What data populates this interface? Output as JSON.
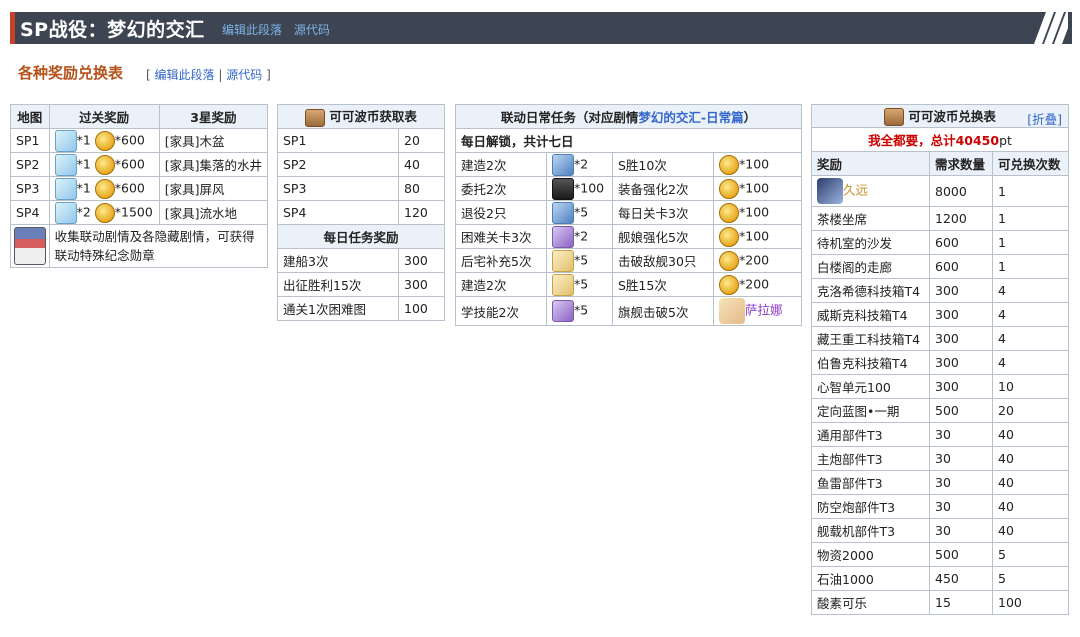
{
  "banner": {
    "title": "SP战役：梦幻的交汇",
    "edit": "编辑此段落",
    "source": "源代码"
  },
  "section": {
    "title": "各种奖励兑换表",
    "open": "[",
    "edit": "编辑此段落",
    "sep": "|",
    "source": "源代码",
    "close": "]"
  },
  "stages": {
    "headers": [
      "地图",
      "过关奖励",
      "3星奖励"
    ],
    "rows": [
      {
        "map": "SP1",
        "q1": "*1",
        "coin": "*600",
        "star": "[家具]木盆"
      },
      {
        "map": "SP2",
        "q1": "*1",
        "coin": "*600",
        "star": "[家具]集落的水井"
      },
      {
        "map": "SP3",
        "q1": "*1",
        "coin": "*600",
        "star": "[家具]屏风"
      },
      {
        "map": "SP4",
        "q1": "*2",
        "coin": "*1500",
        "star": "[家具]流水地"
      }
    ],
    "note": "收集联动剧情及各隐藏剧情，可获得联动特殊纪念勋章"
  },
  "coins": {
    "title": "可可波币获取表",
    "rows": [
      [
        "SP1",
        "20"
      ],
      [
        "SP2",
        "40"
      ],
      [
        "SP3",
        "80"
      ],
      [
        "SP4",
        "120"
      ]
    ],
    "daily_title": "每日任务奖励",
    "daily": [
      [
        "建船3次",
        "300"
      ],
      [
        "出征胜利15次",
        "300"
      ],
      [
        "通关1次困难图",
        "100"
      ]
    ]
  },
  "tasks": {
    "title_prefix": "联动日常任务（对应剧情",
    "title_link": "梦幻的交汇-日常篇",
    "title_suffix": "）",
    "sub": "每日解锁，共计七日",
    "rows": [
      {
        "a": "建造2次",
        "aq": "*2",
        "b": "S胜10次",
        "bq": "*100"
      },
      {
        "a": "委托2次",
        "aq": "*100",
        "b": "装备强化2次",
        "bq": "*100"
      },
      {
        "a": "退役2只",
        "aq": "*5",
        "b": "每日关卡3次",
        "bq": "*100"
      },
      {
        "a": "困难关卡3次",
        "aq": "*2",
        "b": "舰娘强化5次",
        "bq": "*100"
      },
      {
        "a": "后宅补充5次",
        "aq": "*5",
        "b": "击破敌舰30只",
        "bq": "*200"
      },
      {
        "a": "建造2次",
        "aq": "*5",
        "b": "S胜15次",
        "bq": "*200"
      },
      {
        "a": "学技能2次",
        "aq": "*5",
        "b": "旗舰击破5次",
        "bq": "萨拉娜"
      }
    ]
  },
  "exchange": {
    "title": "可可波币兑换表",
    "fold": "[折叠]",
    "total_prefix": "我全都要，总计",
    "total_value": "40450",
    "total_unit": "pt",
    "headers": [
      "奖励",
      "需求数量",
      "可兑换次数"
    ],
    "rows": [
      [
        "久远",
        "8000",
        "1"
      ],
      [
        "茶楼坐席",
        "1200",
        "1"
      ],
      [
        "待机室的沙发",
        "600",
        "1"
      ],
      [
        "白楼阁的走廊",
        "600",
        "1"
      ],
      [
        "克洛希德科技箱T4",
        "300",
        "4"
      ],
      [
        "威斯克科技箱T4",
        "300",
        "4"
      ],
      [
        "藏王重工科技箱T4",
        "300",
        "4"
      ],
      [
        "伯鲁克科技箱T4",
        "300",
        "4"
      ],
      [
        "心智单元100",
        "300",
        "10"
      ],
      [
        "定向蓝图•一期",
        "500",
        "20"
      ],
      [
        "通用部件T3",
        "30",
        "40"
      ],
      [
        "主炮部件T3",
        "30",
        "40"
      ],
      [
        "鱼雷部件T3",
        "30",
        "40"
      ],
      [
        "防空炮部件T3",
        "30",
        "40"
      ],
      [
        "舰载机部件T3",
        "30",
        "40"
      ],
      [
        "物资2000",
        "500",
        "5"
      ],
      [
        "石油1000",
        "450",
        "5"
      ],
      [
        "酸素可乐",
        "15",
        "100"
      ]
    ]
  }
}
